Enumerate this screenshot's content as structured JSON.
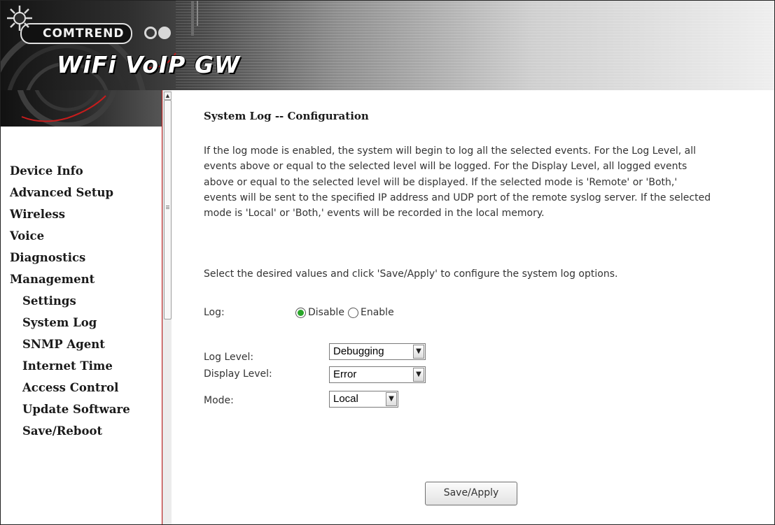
{
  "header": {
    "brand": "COMTREND",
    "product": "WiFi VoIP GW",
    "icons": [
      "sun-logo-icon",
      "swirl-decoration"
    ]
  },
  "sidebar": {
    "items": [
      {
        "label": "Device Info",
        "level": 0
      },
      {
        "label": "Advanced Setup",
        "level": 0
      },
      {
        "label": "Wireless",
        "level": 0
      },
      {
        "label": "Voice",
        "level": 0
      },
      {
        "label": "Diagnostics",
        "level": 0
      },
      {
        "label": "Management",
        "level": 0
      },
      {
        "label": "Settings",
        "level": 1
      },
      {
        "label": "System Log",
        "level": 1
      },
      {
        "label": "SNMP Agent",
        "level": 1
      },
      {
        "label": "Internet Time",
        "level": 1
      },
      {
        "label": "Access Control",
        "level": 1
      },
      {
        "label": "Update Software",
        "level": 1
      },
      {
        "label": "Save/Reboot",
        "level": 1
      }
    ]
  },
  "main": {
    "title": "System Log -- Configuration",
    "description": "If the log mode is enabled, the system will begin to log all the selected events. For the Log Level, all events above or equal to the selected level will be logged. For the Display Level, all logged events above or equal to the selected level will be displayed. If the selected mode is 'Remote' or 'Both,' events will be sent to the specified IP address and UDP port of the remote syslog server. If the selected mode is 'Local' or 'Both,' events will be recorded in the local memory.",
    "instruction": "Select the desired values and click 'Save/Apply' to configure the system log options.",
    "log": {
      "label": "Log:",
      "options": [
        "Disable",
        "Enable"
      ],
      "selected": "Disable"
    },
    "log_level": {
      "label": "Log Level:",
      "value": "Debugging"
    },
    "display_level": {
      "label": "Display Level:",
      "value": "Error"
    },
    "mode": {
      "label": "Mode:",
      "value": "Local"
    },
    "save_label": "Save/Apply"
  },
  "colors": {
    "sidebar_border": "#c81c1c",
    "radio_selected": "#29a629"
  }
}
